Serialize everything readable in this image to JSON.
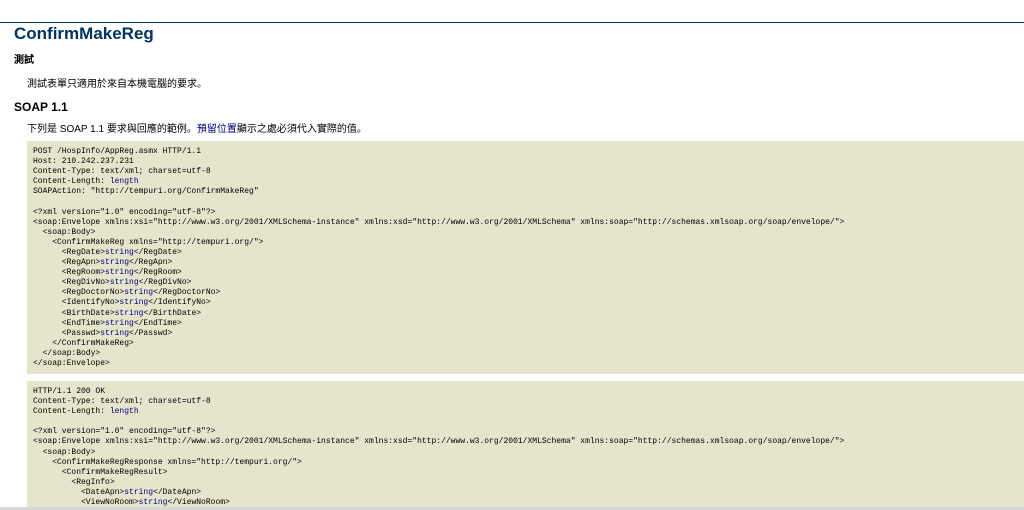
{
  "title": "ConfirmMakeReg",
  "test_section": {
    "heading": "測試",
    "text": "測試表單只適用於來自本機電腦的要求。"
  },
  "soap11": {
    "heading": "SOAP 1.1",
    "description_before": "下列是 SOAP 1.1 要求與回應的範例。",
    "description_placeholder_word": "預留位置",
    "description_after": "顯示之處必須代入實際的值。"
  },
  "colors": {
    "title": "#003366",
    "code_background": "#e5e5cc",
    "placeholder": "#000080"
  },
  "request_lines": [
    [
      {
        "t": "POST /HospInfo/AppReg.asmx HTTP/1.1"
      }
    ],
    [
      {
        "t": "Host: 210.242.237.231"
      }
    ],
    [
      {
        "t": "Content-Type: text/xml; charset=utf-8"
      }
    ],
    [
      {
        "t": "Content-Length: "
      },
      {
        "t": "length",
        "ph": true
      }
    ],
    [
      {
        "t": "SOAPAction: \"http://tempuri.org/ConfirmMakeReg\""
      }
    ],
    [
      {
        "t": ""
      }
    ],
    [
      {
        "t": "<?xml version=\"1.0\" encoding=\"utf-8\"?>"
      }
    ],
    [
      {
        "t": "<soap:Envelope xmlns:xsi=\"http://www.w3.org/2001/XMLSchema-instance\" xmlns:xsd=\"http://www.w3.org/2001/XMLSchema\" xmlns:soap=\"http://schemas.xmlsoap.org/soap/envelope/\">"
      }
    ],
    [
      {
        "t": "  <soap:Body>"
      }
    ],
    [
      {
        "t": "    <ConfirmMakeReg xmlns=\"http://tempuri.org/\">"
      }
    ],
    [
      {
        "t": "      <RegDate>"
      },
      {
        "t": "string",
        "ph": true
      },
      {
        "t": "</RegDate>"
      }
    ],
    [
      {
        "t": "      <RegApn>"
      },
      {
        "t": "string",
        "ph": true
      },
      {
        "t": "</RegApn>"
      }
    ],
    [
      {
        "t": "      <RegRoom>"
      },
      {
        "t": "string",
        "ph": true
      },
      {
        "t": "</RegRoom>"
      }
    ],
    [
      {
        "t": "      <RegDivNo>"
      },
      {
        "t": "string",
        "ph": true
      },
      {
        "t": "</RegDivNo>"
      }
    ],
    [
      {
        "t": "      <RegDoctorNo>"
      },
      {
        "t": "string",
        "ph": true
      },
      {
        "t": "</RegDoctorNo>"
      }
    ],
    [
      {
        "t": "      <IdentifyNo>"
      },
      {
        "t": "string",
        "ph": true
      },
      {
        "t": "</IdentifyNo>"
      }
    ],
    [
      {
        "t": "      <BirthDate>"
      },
      {
        "t": "string",
        "ph": true
      },
      {
        "t": "</BirthDate>"
      }
    ],
    [
      {
        "t": "      <EndTime>"
      },
      {
        "t": "string",
        "ph": true
      },
      {
        "t": "</EndTime>"
      }
    ],
    [
      {
        "t": "      <Passwd>"
      },
      {
        "t": "string",
        "ph": true
      },
      {
        "t": "</Passwd>"
      }
    ],
    [
      {
        "t": "    </ConfirmMakeReg>"
      }
    ],
    [
      {
        "t": "  </soap:Body>"
      }
    ],
    [
      {
        "t": "</soap:Envelope>"
      }
    ]
  ],
  "response_lines": [
    [
      {
        "t": "HTTP/1.1 200 OK"
      }
    ],
    [
      {
        "t": "Content-Type: text/xml; charset=utf-8"
      }
    ],
    [
      {
        "t": "Content-Length: "
      },
      {
        "t": "length",
        "ph": true
      }
    ],
    [
      {
        "t": ""
      }
    ],
    [
      {
        "t": "<?xml version=\"1.0\" encoding=\"utf-8\"?>"
      }
    ],
    [
      {
        "t": "<soap:Envelope xmlns:xsi=\"http://www.w3.org/2001/XMLSchema-instance\" xmlns:xsd=\"http://www.w3.org/2001/XMLSchema\" xmlns:soap=\"http://schemas.xmlsoap.org/soap/envelope/\">"
      }
    ],
    [
      {
        "t": "  <soap:Body>"
      }
    ],
    [
      {
        "t": "    <ConfirmMakeRegResponse xmlns=\"http://tempuri.org/\">"
      }
    ],
    [
      {
        "t": "      <ConfirmMakeRegResult>"
      }
    ],
    [
      {
        "t": "        <RegInfo>"
      }
    ],
    [
      {
        "t": "          <DateApn>"
      },
      {
        "t": "string",
        "ph": true
      },
      {
        "t": "</DateApn>"
      }
    ],
    [
      {
        "t": "          <ViewNoRoom>"
      },
      {
        "t": "string",
        "ph": true
      },
      {
        "t": "</ViewNoRoom>"
      }
    ]
  ]
}
